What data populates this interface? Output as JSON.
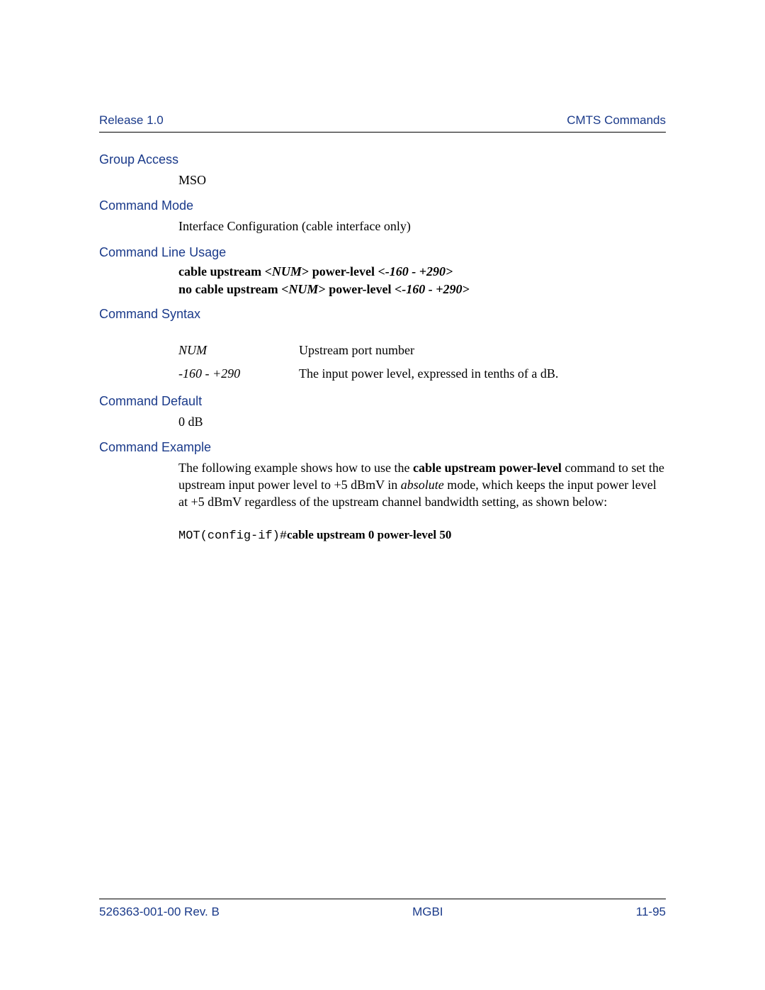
{
  "header": {
    "left": "Release 1.0",
    "right": "CMTS Commands"
  },
  "sections": {
    "groupAccess": {
      "heading": "Group Access",
      "value": "MSO"
    },
    "commandMode": {
      "heading": "Command Mode",
      "value": "Interface Configuration (cable interface only)"
    },
    "commandLineUsage": {
      "heading": "Command Line Usage",
      "line1": {
        "pre": "cable upstream <",
        "arg1": "NUM",
        "mid": "> power-level ",
        "arg2": "<-160 - +290>"
      },
      "line2": {
        "pre": "no cable upstream <",
        "arg1": "NUM",
        "mid": "> power-level ",
        "arg2": "<-160 - +290>"
      }
    },
    "commandSyntax": {
      "heading": "Command Syntax",
      "rows": [
        {
          "param": "NUM",
          "desc": "Upstream port number"
        },
        {
          "param": "-160 - +290",
          "desc": "The input power level, expressed in tenths of a dB."
        }
      ]
    },
    "commandDefault": {
      "heading": "Command Default",
      "value": "0 dB"
    },
    "commandExample": {
      "heading": "Command Example",
      "textParts": {
        "p1": "The following example shows how to use the ",
        "b1": "cable upstream power-level",
        "p2": " command to set the upstream input power level to +5 dBmV in ",
        "i1": "absolute",
        "p3": " mode, which keeps the input power level at +5 dBmV regardless of the upstream channel bandwidth setting, as shown below:"
      },
      "code": {
        "prompt": "MOT(config-if)#",
        "cmd": "cable upstream 0 power-level 50"
      }
    }
  },
  "footer": {
    "left": "526363-001-00 Rev. B",
    "center": "MGBI",
    "right": "11-95"
  }
}
